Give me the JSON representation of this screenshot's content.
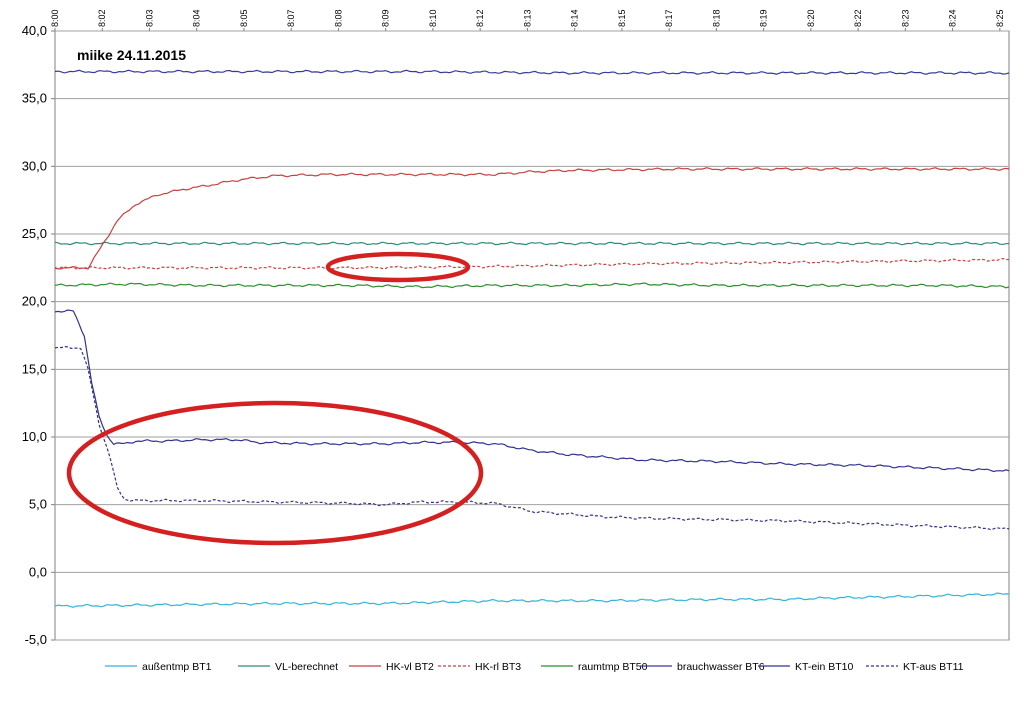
{
  "chart_data": {
    "type": "line",
    "title": "",
    "annotation": "miike 24.11.2015",
    "xlabel": "",
    "ylabel": "",
    "ylim": [
      -5,
      40
    ],
    "yticks": [
      "-5,0",
      "0,0",
      "5,0",
      "10,0",
      "15,0",
      "20,0",
      "25,0",
      "30,0",
      "35,0",
      "40,0"
    ],
    "xticks": [
      "8:00",
      "8:02",
      "8:03",
      "8:04",
      "8:05",
      "8:07",
      "8:08",
      "8:09",
      "8:10",
      "8:12",
      "8:13",
      "8:14",
      "8:15",
      "8:17",
      "8:18",
      "8:19",
      "8:20",
      "8:22",
      "8:23",
      "8:24",
      "8:25"
    ],
    "xlim": [
      0,
      26
    ],
    "grid": true,
    "legend_position": "bottom",
    "series": [
      {
        "name": "außentmp BT1",
        "color": "#33b5d9",
        "dash": "solid",
        "points": [
          [
            0,
            -2.5
          ],
          [
            3,
            -2.4
          ],
          [
            6,
            -2.3
          ],
          [
            9,
            -2.3
          ],
          [
            12,
            -2.1
          ],
          [
            15,
            -2.1
          ],
          [
            18,
            -2.0
          ],
          [
            20,
            -2.0
          ],
          [
            21,
            -1.9
          ],
          [
            23,
            -1.8
          ],
          [
            26,
            -1.6
          ]
        ]
      },
      {
        "name": "VL-berechnet",
        "color": "#2e8b7a",
        "dash": "solid",
        "points": [
          [
            0,
            24.3
          ],
          [
            26,
            24.3
          ]
        ]
      },
      {
        "name": "HK-vl BT2",
        "color": "#c84040",
        "dash": "solid",
        "points": [
          [
            0,
            22.5
          ],
          [
            0.9,
            22.5
          ],
          [
            1.3,
            24.2
          ],
          [
            1.7,
            26.0
          ],
          [
            2.2,
            27.2
          ],
          [
            2.8,
            27.9
          ],
          [
            3.5,
            28.3
          ],
          [
            4.2,
            28.6
          ],
          [
            5.0,
            29.0
          ],
          [
            6.0,
            29.3
          ],
          [
            7.5,
            29.4
          ],
          [
            12.0,
            29.4
          ],
          [
            13.0,
            29.6
          ],
          [
            14.0,
            29.7
          ],
          [
            17.0,
            29.8
          ],
          [
            21.0,
            29.8
          ],
          [
            26.0,
            29.8
          ]
        ]
      },
      {
        "name": "HK-rl BT3",
        "color": "#c84040",
        "dash": "dashed",
        "points": [
          [
            0,
            22.5
          ],
          [
            8.0,
            22.5
          ],
          [
            12.0,
            22.6
          ],
          [
            16.0,
            22.8
          ],
          [
            20.0,
            22.9
          ],
          [
            26.0,
            23.1
          ]
        ]
      },
      {
        "name": "raumtmp BT50",
        "color": "#2f8f2f",
        "dash": "solid",
        "points": [
          [
            0,
            21.2
          ],
          [
            2,
            21.3
          ],
          [
            4,
            21.2
          ],
          [
            6,
            21.2
          ],
          [
            8,
            21.2
          ],
          [
            10,
            21.1
          ],
          [
            12,
            21.2
          ],
          [
            14,
            21.2
          ],
          [
            16,
            21.3
          ],
          [
            18,
            21.2
          ],
          [
            20,
            21.2
          ],
          [
            22,
            21.2
          ],
          [
            24,
            21.2
          ],
          [
            26,
            21.1
          ]
        ]
      },
      {
        "name": "brauchwasser BT6",
        "color": "#3a3a9e",
        "dash": "solid",
        "points": [
          [
            0,
            37.0
          ],
          [
            6,
            37.0
          ],
          [
            10,
            37.0
          ],
          [
            14,
            36.9
          ],
          [
            18,
            36.9
          ],
          [
            22,
            36.9
          ],
          [
            26,
            36.9
          ]
        ]
      },
      {
        "name": "KT-ein BT10",
        "color": "#33338f",
        "dash": "solid",
        "points": [
          [
            0,
            19.3
          ],
          [
            0.5,
            19.3
          ],
          [
            0.8,
            17.5
          ],
          [
            1.0,
            14.0
          ],
          [
            1.2,
            11.5
          ],
          [
            1.4,
            10.2
          ],
          [
            1.6,
            9.5
          ],
          [
            1.9,
            9.5
          ],
          [
            2.2,
            9.7
          ],
          [
            3.0,
            9.7
          ],
          [
            4.0,
            9.8
          ],
          [
            5.0,
            9.8
          ],
          [
            5.5,
            9.6
          ],
          [
            7.0,
            9.5
          ],
          [
            9.0,
            9.5
          ],
          [
            10.0,
            9.6
          ],
          [
            11.0,
            9.6
          ],
          [
            12.0,
            9.5
          ],
          [
            13.0,
            9.0
          ],
          [
            14.0,
            8.7
          ],
          [
            15.0,
            8.5
          ],
          [
            16.0,
            8.3
          ],
          [
            18.0,
            8.2
          ],
          [
            20.0,
            8.0
          ],
          [
            22.0,
            7.9
          ],
          [
            24.0,
            7.7
          ],
          [
            25.0,
            7.6
          ],
          [
            26.0,
            7.5
          ]
        ]
      },
      {
        "name": "KT-aus BT11",
        "color": "#33338f",
        "dash": "dashed",
        "points": [
          [
            0,
            16.6
          ],
          [
            0.7,
            16.6
          ],
          [
            0.9,
            15.0
          ],
          [
            1.2,
            11.0
          ],
          [
            1.5,
            8.5
          ],
          [
            1.7,
            6.2
          ],
          [
            1.9,
            5.4
          ],
          [
            2.2,
            5.3
          ],
          [
            4.0,
            5.3
          ],
          [
            6.0,
            5.2
          ],
          [
            8.0,
            5.1
          ],
          [
            9.0,
            5.0
          ],
          [
            10.0,
            5.2
          ],
          [
            11.0,
            5.2
          ],
          [
            12.0,
            5.1
          ],
          [
            13.0,
            4.5
          ],
          [
            14.0,
            4.3
          ],
          [
            15.0,
            4.1
          ],
          [
            16.0,
            4.0
          ],
          [
            18.0,
            3.9
          ],
          [
            20.0,
            3.8
          ],
          [
            22.0,
            3.6
          ],
          [
            24.0,
            3.4
          ],
          [
            26.0,
            3.2
          ]
        ]
      }
    ],
    "highlight_ellipses": [
      {
        "color": "#d42020"
      },
      {
        "color": "#d42020"
      }
    ]
  }
}
